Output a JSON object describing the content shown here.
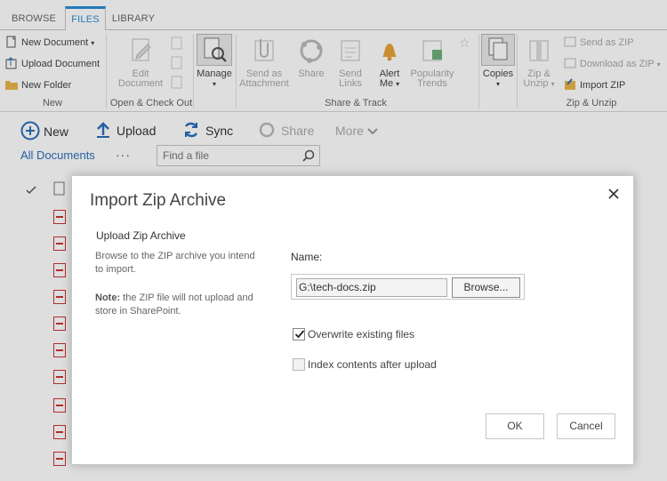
{
  "tabs": [
    {
      "label": "BROWSE"
    },
    {
      "label": "FILES"
    },
    {
      "label": "LIBRARY"
    }
  ],
  "ribbon": {
    "new_group": {
      "new_document": "New Document",
      "upload_document": "Upload Document",
      "new_folder": "New Folder",
      "label": "New"
    },
    "open_checkout": {
      "edit_document": "Edit Document",
      "label": "Open & Check Out"
    },
    "manage": "Manage",
    "share_track": {
      "send_as_attachment": "Send as Attachment",
      "share": "Share",
      "send_links": "Send Links",
      "alert_me": "Alert Me",
      "popularity_trends": "Popularity Trends",
      "label": "Share & Track"
    },
    "copies": "Copies",
    "zip_group": {
      "zip_unzip": "Zip & Unzip",
      "send_as_zip": "Send as ZIP",
      "download_as_zip": "Download as ZIP",
      "import_zip": "Import ZIP",
      "label": "Zip & Unzip"
    }
  },
  "commands": {
    "new": "New",
    "upload": "Upload",
    "sync": "Sync",
    "share": "Share",
    "more": "More"
  },
  "view": {
    "all_documents": "All Documents",
    "ellipsis": "···",
    "find_placeholder": "Find a file"
  },
  "dialog": {
    "title": "Import Zip Archive",
    "section_title": "Upload Zip Archive",
    "section_desc": "Browse to the ZIP archive you intend to import.",
    "note_label": "Note:",
    "note_text": " the ZIP file will not upload and store in SharePoint.",
    "name_label": "Name:",
    "file_value": "G:\\tech-docs.zip",
    "browse_label": "Browse...",
    "overwrite_label": "Overwrite existing files",
    "overwrite_checked": true,
    "index_label": "Index contents after upload",
    "index_checked": false,
    "ok_label": "OK",
    "cancel_label": "Cancel"
  },
  "colors": {
    "accent": "#2a8dd4",
    "link": "#2a6ebb",
    "pdf_red": "#cc3333"
  }
}
